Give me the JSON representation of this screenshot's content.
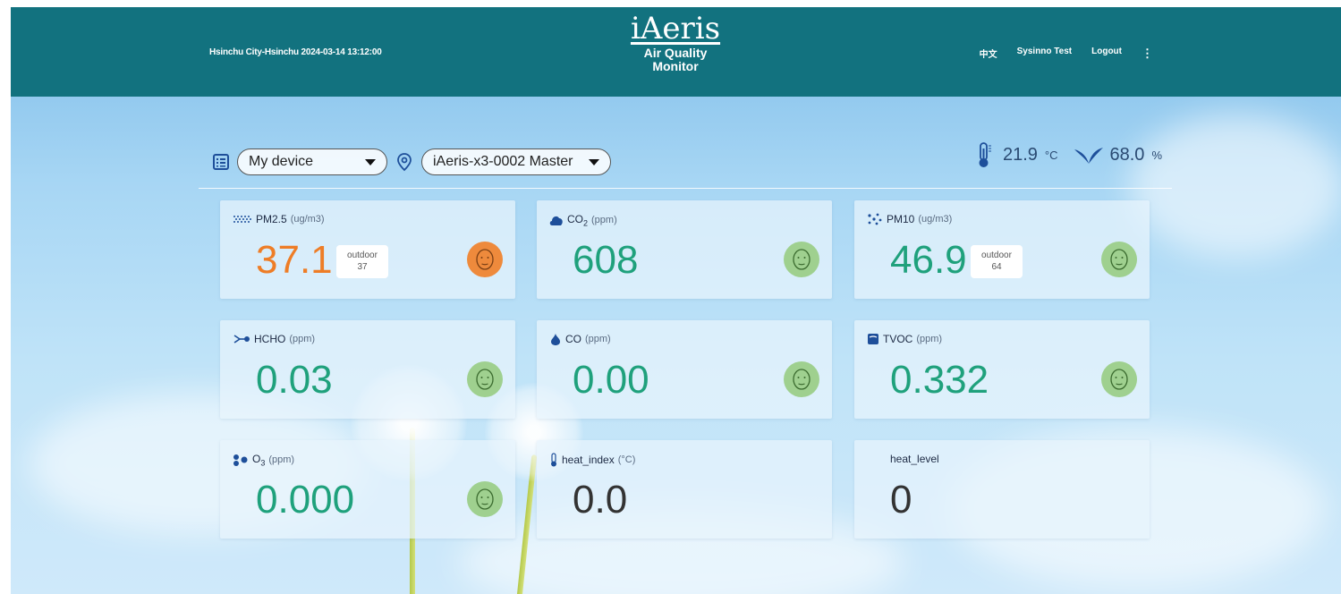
{
  "header": {
    "location_time": "Hsinchu City-Hsinchu 2024-03-14 13:12:00",
    "logo": "iAeris",
    "subtitle_line1": "Air Quality",
    "subtitle_line2": "Monitor",
    "nav": {
      "lang": "中文",
      "user": "Sysinno Test",
      "logout": "Logout",
      "more": "⋮"
    }
  },
  "controls": {
    "device_group": "My device",
    "device_name": "iAeris-x3-0002 Master"
  },
  "environment": {
    "temperature": "21.9",
    "temperature_unit": "°C",
    "humidity": "68.0",
    "humidity_unit": "%"
  },
  "cards": {
    "pm25": {
      "name": "PM2.5",
      "unit": "(ug/m3)",
      "value": "37.1",
      "outdoor_label": "outdoor",
      "outdoor_value": "37",
      "status_color": "#ee8a3c"
    },
    "co2": {
      "name": "CO",
      "sub": "2",
      "unit": "(ppm)",
      "value": "608",
      "status_color": "#9fd08f"
    },
    "pm10": {
      "name": "PM10",
      "unit": "(ug/m3)",
      "value": "46.9",
      "outdoor_label": "outdoor",
      "outdoor_value": "64",
      "status_color": "#9fd08f"
    },
    "hcho": {
      "name": "HCHO",
      "unit": "(ppm)",
      "value": "0.03",
      "status_color": "#9fd08f"
    },
    "co": {
      "name": "CO",
      "unit": "(ppm)",
      "value": "0.00",
      "status_color": "#9fd08f"
    },
    "tvoc": {
      "name": "TVOC",
      "unit": "(ppm)",
      "value": "0.332",
      "status_color": "#9fd08f"
    },
    "o3": {
      "name": "O",
      "sub": "3",
      "unit": "(ppm)",
      "value": "0.000",
      "status_color": "#9fd08f"
    },
    "heat_index": {
      "name": "heat_index",
      "unit": "(°C)",
      "value": "0.0"
    },
    "heat_level": {
      "name": "heat_level",
      "value": "0"
    }
  },
  "colors": {
    "header": "#12727f",
    "good": "#1fa17c",
    "moderate": "#ee7d26",
    "icon": "#1e4f9a"
  }
}
